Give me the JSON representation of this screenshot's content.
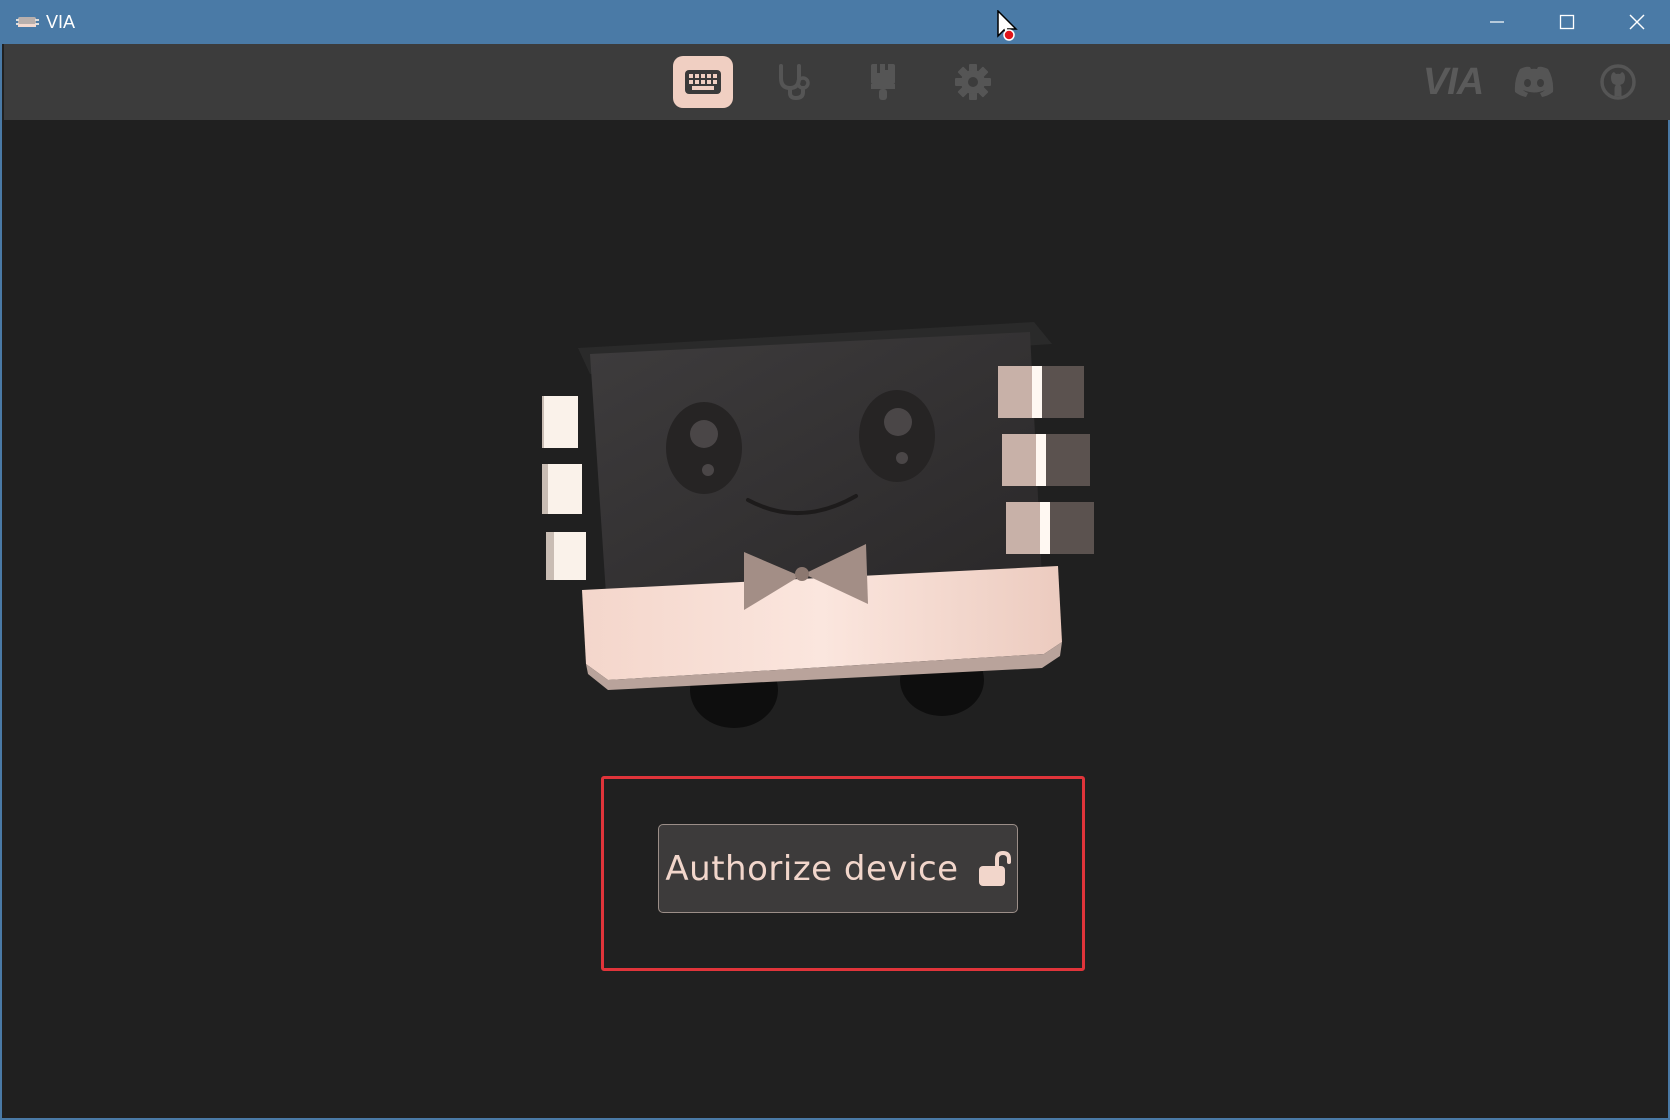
{
  "window": {
    "title": "VIA",
    "controls": [
      "minimize",
      "maximize",
      "close"
    ]
  },
  "toolbar": {
    "nav": [
      {
        "name": "configure",
        "icon": "keyboard-icon",
        "active": true
      },
      {
        "name": "test",
        "icon": "stethoscope-icon",
        "active": false
      },
      {
        "name": "design",
        "icon": "paintbrush-icon",
        "active": false
      },
      {
        "name": "settings",
        "icon": "gear-icon",
        "active": false
      }
    ],
    "links": [
      {
        "name": "via",
        "label": "VIA",
        "icon": "via-logo"
      },
      {
        "name": "discord",
        "icon": "discord-icon"
      },
      {
        "name": "github",
        "icon": "github-icon"
      }
    ]
  },
  "main": {
    "authorize_label": "Authorize device",
    "authorize_icon": "unlock-icon"
  },
  "colors": {
    "titlebar": "#4a7aa6",
    "toolbar": "#3c3c3c",
    "background": "#202020",
    "accent": "#f0cfc2",
    "highlight": "#e0343a",
    "button_text": "#f2d6cb"
  }
}
